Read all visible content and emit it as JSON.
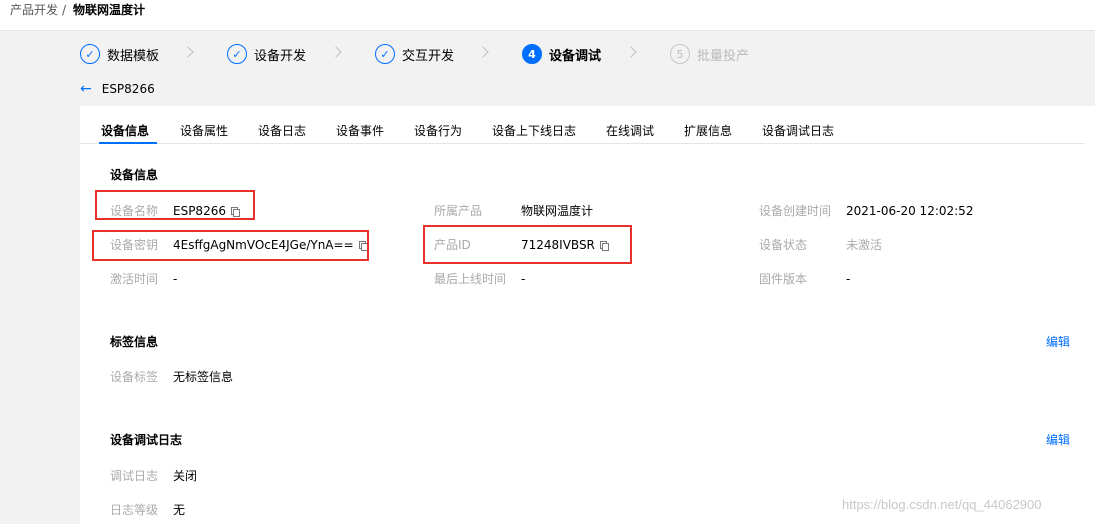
{
  "breadcrumb": {
    "parent": "产品开发",
    "separator": "/",
    "current": "物联网温度计"
  },
  "steps": [
    {
      "num": "✓",
      "label": "数据模板",
      "state": "done"
    },
    {
      "num": "✓",
      "label": "设备开发",
      "state": "done"
    },
    {
      "num": "✓",
      "label": "交互开发",
      "state": "done"
    },
    {
      "num": "4",
      "label": "设备调试",
      "state": "active"
    },
    {
      "num": "5",
      "label": "批量投产",
      "state": "pending"
    }
  ],
  "header": {
    "back_icon": "←",
    "device_name": "ESP8266"
  },
  "tabs": [
    "设备信息",
    "设备属性",
    "设备日志",
    "设备事件",
    "设备行为",
    "设备上下线日志",
    "在线调试",
    "扩展信息",
    "设备调试日志"
  ],
  "device_info": {
    "title": "设备信息",
    "name_label": "设备名称",
    "name_value": "ESP8266",
    "secret_label": "设备密钥",
    "secret_value": "4EsffgAgNmVOcE4JGe/YnA==",
    "activated_label": "激活时间",
    "activated_value": "-",
    "product_label": "所属产品",
    "product_value": "物联网温度计",
    "product_id_label": "产品ID",
    "product_id_value": "71248IVBSR",
    "last_online_label": "最后上线时间",
    "last_online_value": "-",
    "created_label": "设备创建时间",
    "created_value": "2021-06-20 12:02:52",
    "status_label": "设备状态",
    "status_value": "未激活",
    "firmware_label": "固件版本",
    "firmware_value": "-"
  },
  "tag_info": {
    "title": "标签信息",
    "edit": "编辑",
    "tag_label": "设备标签",
    "tag_value": "无标签信息"
  },
  "debug_log": {
    "title": "设备调试日志",
    "edit": "编辑",
    "log_label": "调试日志",
    "log_value": "关闭",
    "level_label": "日志等级",
    "level_value": "无"
  },
  "watermark": "https://blog.csdn.net/qq_44062900",
  "colors": {
    "accent": "#006eff",
    "highlight_box": "#e8312a"
  }
}
